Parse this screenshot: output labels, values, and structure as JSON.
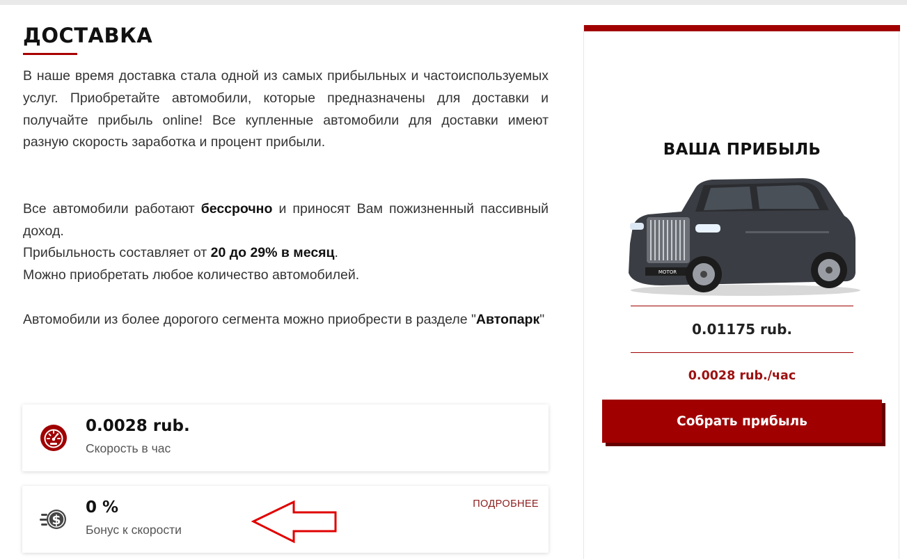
{
  "delivery": {
    "title": "ДОСТАВКА",
    "p1": "В наше время доставка стала одной из самых прибыльных и частоиспользуемых услуг. Приобретайте автомобили, которые предназначены для доставки и получайте прибыль online! Все купленные автомобили для доставки имеют разную скорость заработка и процент прибыли.",
    "p2_pre": "Все автомобили работают ",
    "p2_bold": "бессрочно",
    "p2_post": " и приносят Вам пожизненный пассивный доход.",
    "p3_pre": "Прибыльность составляет от ",
    "p3_bold": "20 до 29% в месяц",
    "p3_post": ".",
    "p4": "Можно приобретать любое количество автомобилей.",
    "p5_pre": "Автомобили из более дорогого сегмента можно приобрести в разделе \"",
    "p5_bold": "Автопарк",
    "p5_post": "\""
  },
  "stats": {
    "speed": {
      "value": "0.0028 rub.",
      "label": "Скорость в час",
      "icon": "speedometer-icon"
    },
    "bonus": {
      "value": "0 %",
      "label": "Бонус к скорости",
      "icon": "coin-speed-icon",
      "link": "ПОДРОБНЕЕ"
    }
  },
  "profit": {
    "title": "ВАША ПРИБЫЛЬ",
    "balance": "0.01175 rub.",
    "rate": "0.0028 rub./час",
    "button": "Собрать прибыль",
    "car_plate": "MOTOR"
  },
  "colors": {
    "accent": "#a00000",
    "accent_dark": "#660000",
    "annotation_arrow": "#e00000"
  }
}
